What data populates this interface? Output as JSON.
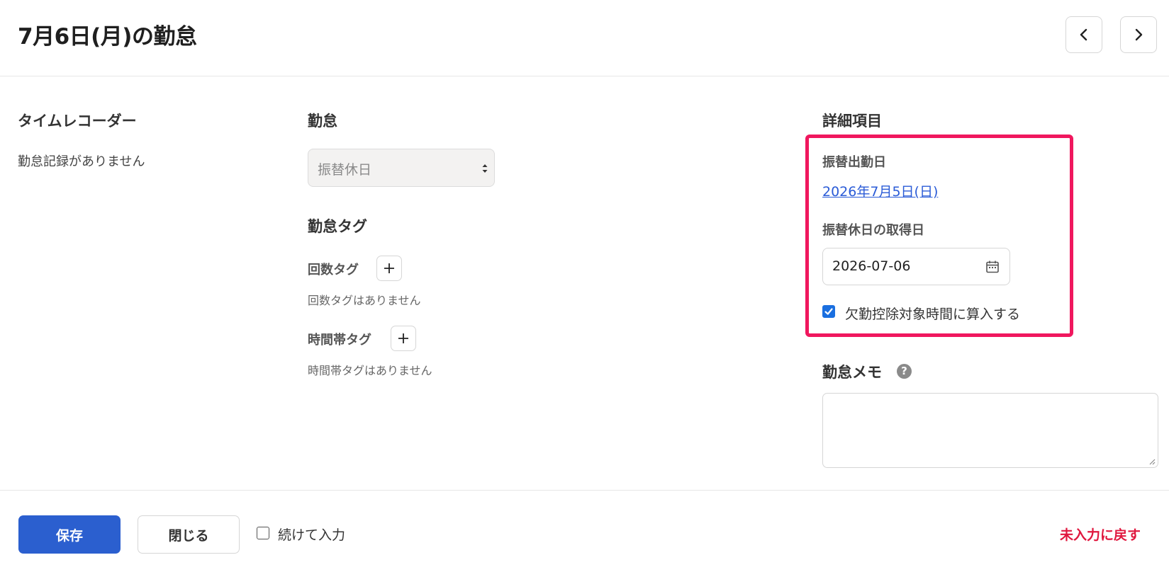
{
  "header": {
    "title": "7月6日(月)の勤怠",
    "prev_icon": "chevron-left-icon",
    "next_icon": "chevron-right-icon"
  },
  "time_recorder": {
    "title": "タイムレコーダー",
    "empty_text": "勤怠記録がありません"
  },
  "attendance": {
    "title": "勤怠",
    "select_value": "振替休日",
    "tags": {
      "title": "勤怠タグ",
      "count_tag_label": "回数タグ",
      "count_tag_empty": "回数タグはありません",
      "time_tag_label": "時間帯タグ",
      "time_tag_empty": "時間帯タグはありません"
    }
  },
  "details": {
    "title": "詳細項目",
    "substitute_work_label": "振替出勤日",
    "substitute_work_date": "2026年7月5日(日)",
    "substitute_holiday_label": "振替休日の取得日",
    "substitute_holiday_date": "2026-07-06",
    "deduction_checkbox_label": "欠勤控除対象時間に算入する",
    "deduction_checked": true,
    "highlight_color": "#f0175e"
  },
  "memo": {
    "title": "勤怠メモ",
    "help_symbol": "?",
    "value": ""
  },
  "footer": {
    "save_label": "保存",
    "close_label": "閉じる",
    "continue_label": "続けて入力",
    "continue_checked": false,
    "reset_label": "未入力に戻す"
  },
  "colors": {
    "primary": "#2b5fcf",
    "link": "#2a5bd7",
    "danger": "#e0173e",
    "checkbox": "#1a6fe0"
  }
}
